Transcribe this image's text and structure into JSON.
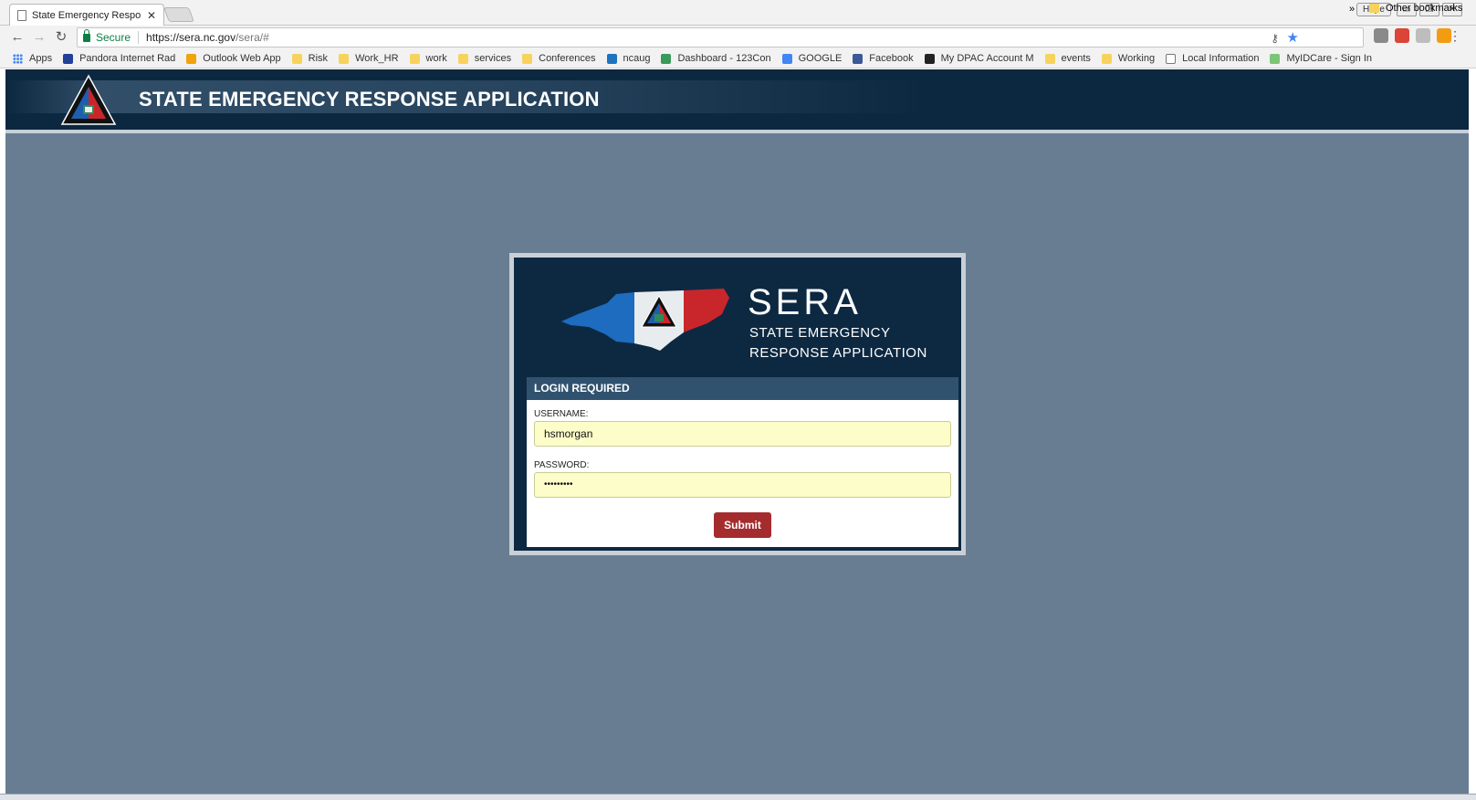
{
  "browser": {
    "tab_title": "State Emergency Respon",
    "profile_label": "Hope",
    "secure_label": "Secure",
    "url_host": "https://sera.nc.gov",
    "url_path": "/sera/#",
    "bookmarks": [
      {
        "label": "Apps",
        "icon": "apps-icon"
      },
      {
        "label": "Pandora Internet Rad",
        "icon": "pandora-icon"
      },
      {
        "label": "Outlook Web App",
        "icon": "outlook-icon"
      },
      {
        "label": "Risk",
        "icon": "folder-icon"
      },
      {
        "label": "Work_HR",
        "icon": "folder-icon"
      },
      {
        "label": "work",
        "icon": "folder-icon"
      },
      {
        "label": "services",
        "icon": "folder-icon"
      },
      {
        "label": "Conferences",
        "icon": "folder-icon"
      },
      {
        "label": "ncaug",
        "icon": "ncaug-icon"
      },
      {
        "label": "Dashboard - 123Con",
        "icon": "dashboard-icon"
      },
      {
        "label": "GOOGLE",
        "icon": "google-icon"
      },
      {
        "label": "Facebook",
        "icon": "facebook-icon"
      },
      {
        "label": "My DPAC Account M",
        "icon": "dpac-icon"
      },
      {
        "label": "events",
        "icon": "folder-icon"
      },
      {
        "label": "Working",
        "icon": "folder-icon"
      },
      {
        "label": "Local Information",
        "icon": "page-icon"
      },
      {
        "label": "MyIDCare - Sign In",
        "icon": "myidcare-icon"
      }
    ],
    "more_label": "»",
    "other_bookmarks": "Other bookmarks"
  },
  "app": {
    "header_title": "STATE EMERGENCY RESPONSE APPLICATION"
  },
  "login": {
    "brand_name": "SERA",
    "brand_sub1": "STATE EMERGENCY",
    "brand_sub2": "RESPONSE APPLICATION",
    "heading": "LOGIN REQUIRED",
    "username_label": "USERNAME:",
    "username_value": "hsmorgan",
    "password_label": "PASSWORD:",
    "password_value": "•••••••••",
    "submit_label": "Submit"
  }
}
